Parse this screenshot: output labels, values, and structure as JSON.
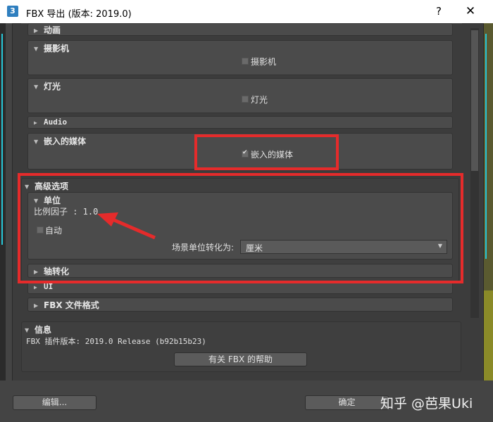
{
  "window": {
    "title": "FBX 导出 (版本: 2019.0)",
    "icon_text": "3",
    "help_label": "?",
    "close_label": "✕"
  },
  "rollouts": {
    "animation": {
      "label": "动画"
    },
    "camera": {
      "label": "摄影机",
      "checkbox_label": "摄影机",
      "checked": false
    },
    "light": {
      "label": "灯光",
      "checkbox_label": "灯光",
      "checked": false
    },
    "audio": {
      "label": "Audio"
    },
    "embed_media": {
      "label": "嵌入的媒体",
      "checkbox_label": "嵌入的媒体",
      "checked": true
    },
    "advanced": {
      "label": "高级选项",
      "units": {
        "label": "单位",
        "scale_factor_text": "比例因子 : 1.0",
        "auto_label": "自动",
        "auto_checked": false,
        "convert_label": "场景单位转化为:",
        "convert_value": "厘米"
      },
      "axis": {
        "label": "轴转化"
      },
      "ui": {
        "label": "UI"
      },
      "fbx_format": {
        "label": "FBX 文件格式"
      }
    },
    "info": {
      "label": "信息",
      "version_text": "FBX 插件版本: 2019.0 Release (b92b15b23)",
      "help_button": "有关 FBX 的帮助"
    }
  },
  "footer": {
    "edit_button": "编辑...",
    "ok_button": "确定"
  },
  "watermark": "知乎 @芭果Uki",
  "colors": {
    "highlight_red": "#e52b2b",
    "accent_cyan": "#27c8d9"
  }
}
